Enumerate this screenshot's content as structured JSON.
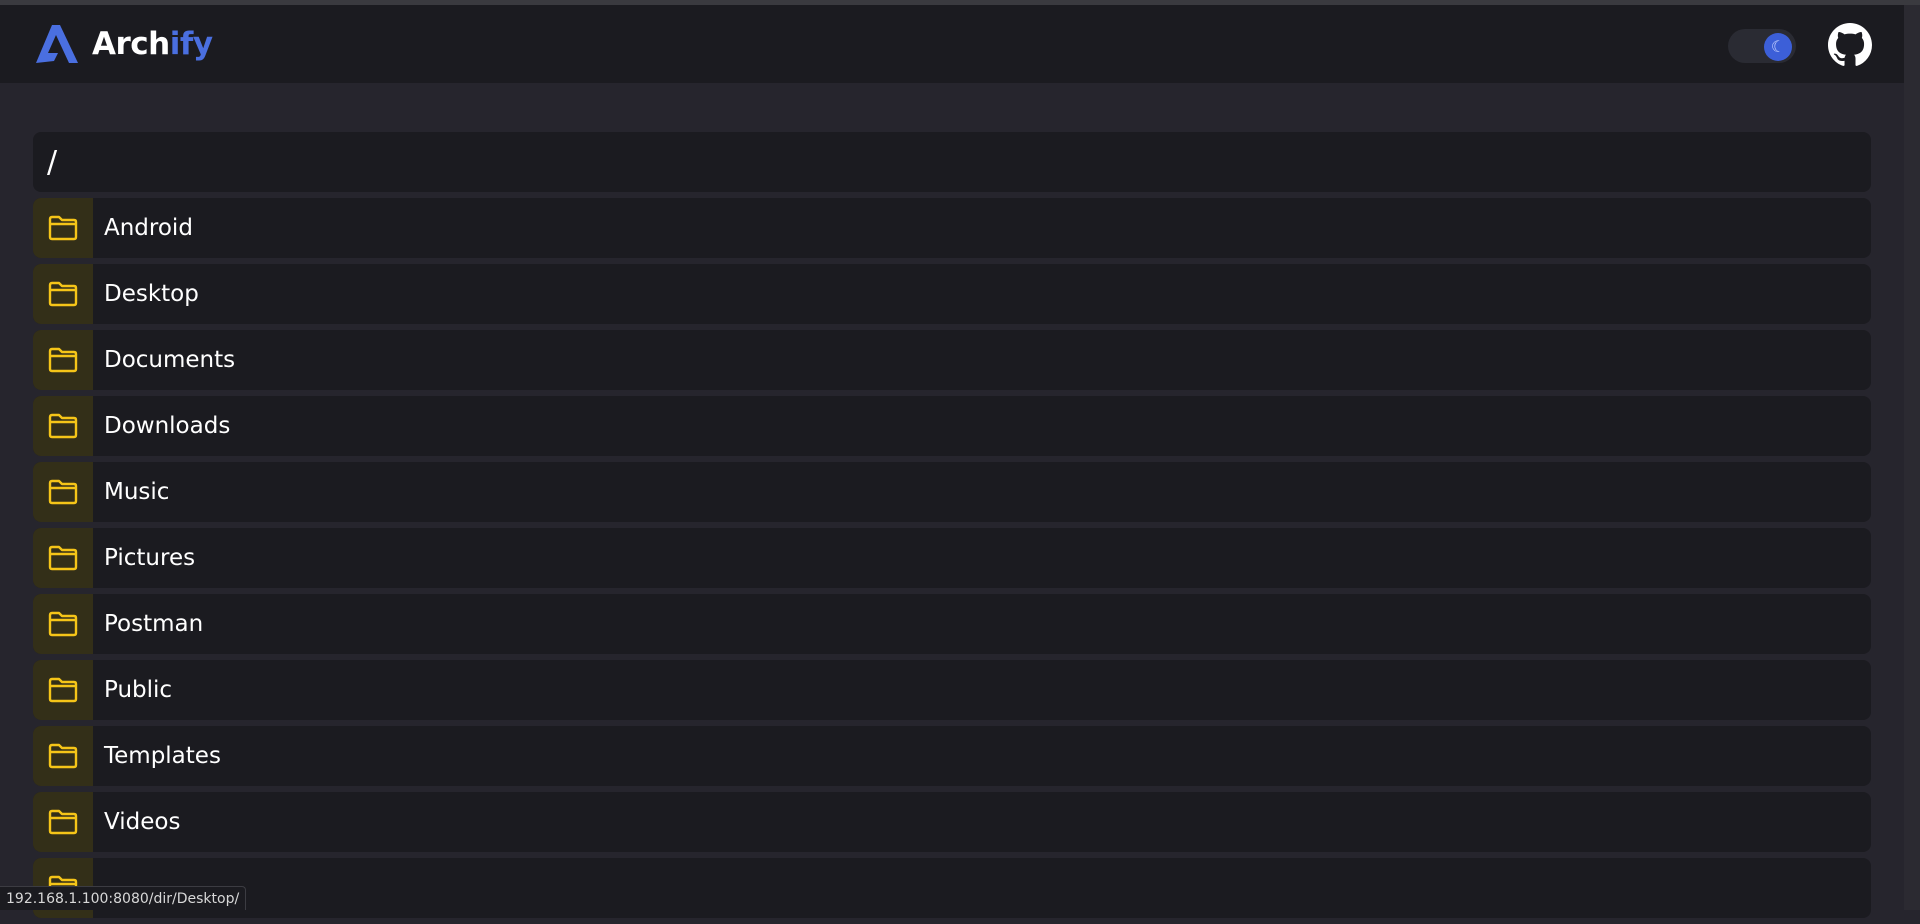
{
  "app": {
    "brand_prefix": "Arch",
    "brand_accent": "ify",
    "accent_color": "#4a6fe0",
    "folder_color": "#f5c518",
    "theme_toggle_icon": "moon-icon",
    "github_icon": "github-icon"
  },
  "path": "/",
  "folders": [
    {
      "name": "Android",
      "icon": "folder-icon"
    },
    {
      "name": "Desktop",
      "icon": "folder-icon"
    },
    {
      "name": "Documents",
      "icon": "folder-icon"
    },
    {
      "name": "Downloads",
      "icon": "folder-icon"
    },
    {
      "name": "Music",
      "icon": "folder-icon"
    },
    {
      "name": "Pictures",
      "icon": "folder-icon"
    },
    {
      "name": "Postman",
      "icon": "folder-icon"
    },
    {
      "name": "Public",
      "icon": "folder-icon"
    },
    {
      "name": "Templates",
      "icon": "folder-icon"
    },
    {
      "name": "Videos",
      "icon": "folder-icon"
    },
    {
      "name": "",
      "icon": "folder-icon"
    }
  ],
  "status_bar": {
    "url": "192.168.1.100:8080/dir/Desktop/"
  }
}
